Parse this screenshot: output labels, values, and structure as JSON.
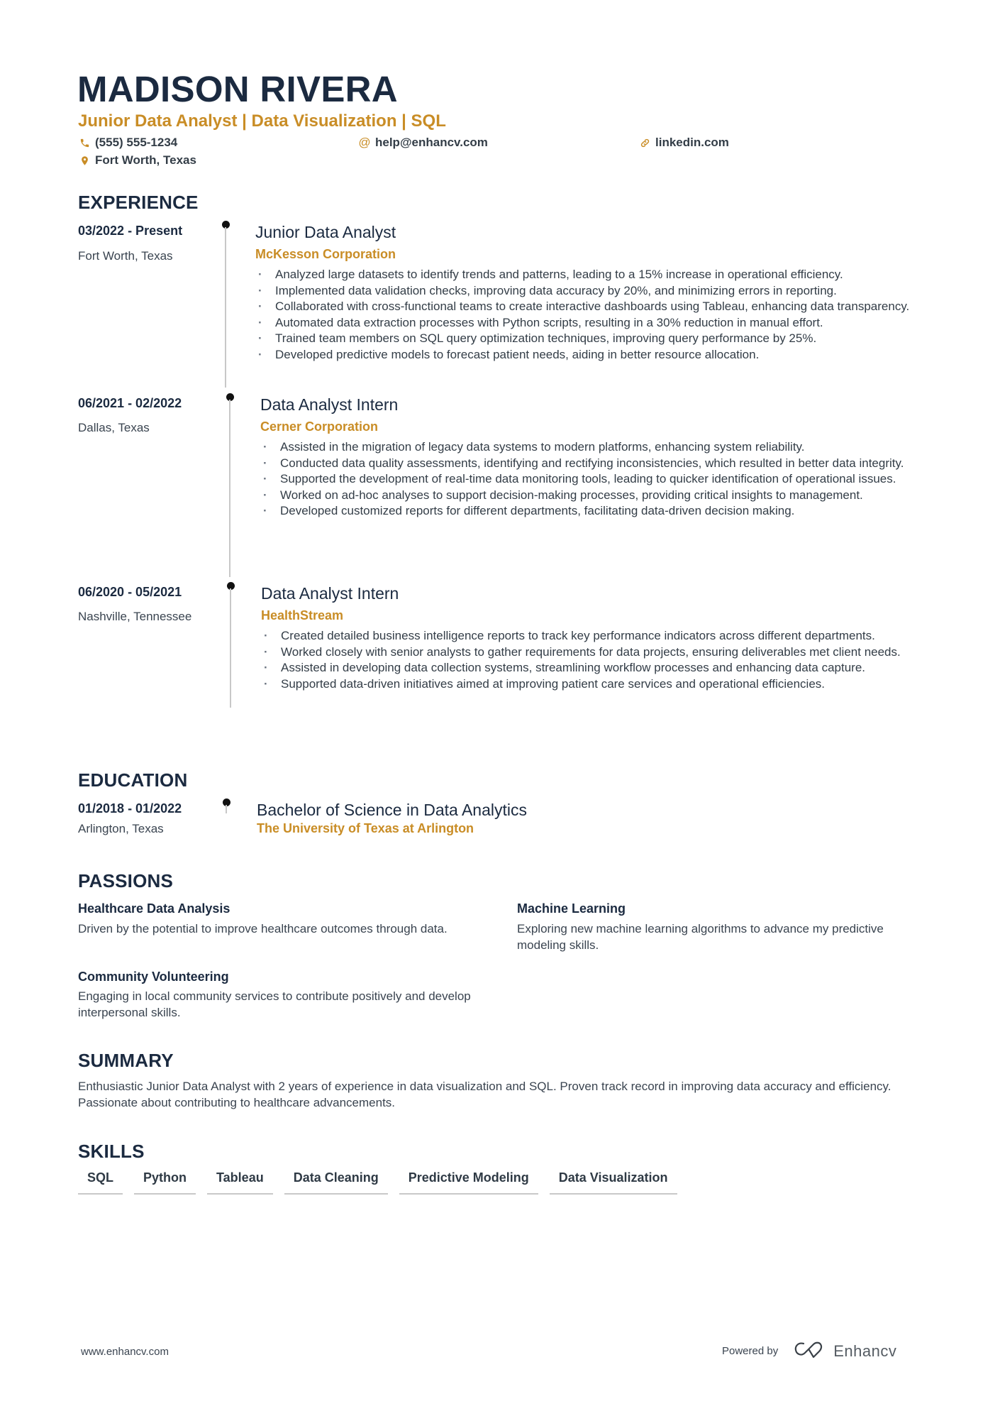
{
  "header": {
    "name": "MADISON RIVERA",
    "subtitle": "Junior Data Analyst | Data Visualization | SQL",
    "contacts": [
      {
        "icon": "phone-icon",
        "text": "(555) 555-1234"
      },
      {
        "icon": "at-icon",
        "text": "help@enhancv.com"
      },
      {
        "icon": "link-icon",
        "text": "linkedin.com"
      },
      {
        "icon": "location-pin-icon",
        "text": "Fort Worth, Texas"
      }
    ]
  },
  "colors": {
    "accent": "#c98d26",
    "heading": "#1b2a40",
    "body": "#333d47",
    "timeline_dot": "#111111",
    "timeline_line": "#c8c8c8"
  },
  "experience": {
    "title": "EXPERIENCE",
    "items": [
      {
        "dates": "03/2022 - Present",
        "location": "Fort Worth, Texas",
        "role": "Junior Data Analyst",
        "company": "McKesson Corporation",
        "bullets": [
          "Analyzed large datasets to identify trends and patterns, leading to a 15% increase in operational efficiency.",
          "Implemented data validation checks, improving data accuracy by 20%, and minimizing errors in reporting.",
          "Collaborated with cross-functional teams to create interactive dashboards using Tableau, enhancing data transparency.",
          "Automated data extraction processes with Python scripts, resulting in a 30% reduction in manual effort.",
          "Trained team members on SQL query optimization techniques, improving query performance by 25%.",
          "Developed predictive models to forecast patient needs, aiding in better resource allocation."
        ]
      },
      {
        "dates": "06/2021 - 02/2022",
        "location": "Dallas, Texas",
        "role": "Data Analyst Intern",
        "company": "Cerner Corporation",
        "bullets": [
          "Assisted in the migration of legacy data systems to modern platforms, enhancing system reliability.",
          "Conducted data quality assessments, identifying and rectifying inconsistencies, which resulted in better data integrity.",
          "Supported the development of real-time data monitoring tools, leading to quicker identification of operational issues.",
          "Worked on ad-hoc analyses to support decision-making processes, providing critical insights to management.",
          "Developed customized reports for different departments, facilitating data-driven decision making."
        ]
      },
      {
        "dates": "06/2020 - 05/2021",
        "location": "Nashville, Tennessee",
        "role": "Data Analyst Intern",
        "company": "HealthStream",
        "bullets": [
          "Created detailed business intelligence reports to track key performance indicators across different departments.",
          "Worked closely with senior analysts to gather requirements for data projects, ensuring deliverables met client needs.",
          "Assisted in developing data collection systems, streamlining workflow processes and enhancing data capture.",
          "Supported data-driven initiatives aimed at improving patient care services and operational efficiencies."
        ]
      }
    ]
  },
  "education": {
    "title": "EDUCATION",
    "items": [
      {
        "dates": "01/2018 - 01/2022",
        "location": "Arlington, Texas",
        "degree": "Bachelor of Science in Data Analytics",
        "school": "The University of Texas at Arlington"
      }
    ]
  },
  "passions": {
    "title": "PASSIONS",
    "items": [
      {
        "title": "Healthcare Data Analysis",
        "desc": "Driven by the potential to improve healthcare outcomes through data."
      },
      {
        "title": "Machine Learning",
        "desc": "Exploring new machine learning algorithms to advance my predictive modeling skills."
      },
      {
        "title": "Community Volunteering",
        "desc": "Engaging in local community services to contribute positively and develop interpersonal skills."
      }
    ]
  },
  "summary": {
    "title": "SUMMARY",
    "text": "Enthusiastic Junior Data Analyst with 2 years of experience in data visualization and SQL. Proven track record in improving data accuracy and efficiency. Passionate about contributing to healthcare advancements."
  },
  "skills": {
    "title": "SKILLS",
    "items": [
      "SQL",
      "Python",
      "Tableau",
      "Data Cleaning",
      "Predictive Modeling",
      "Data Visualization"
    ]
  },
  "footer": {
    "website": "www.enhancv.com",
    "powered_by": "Powered by",
    "brand": "Enhancv"
  }
}
